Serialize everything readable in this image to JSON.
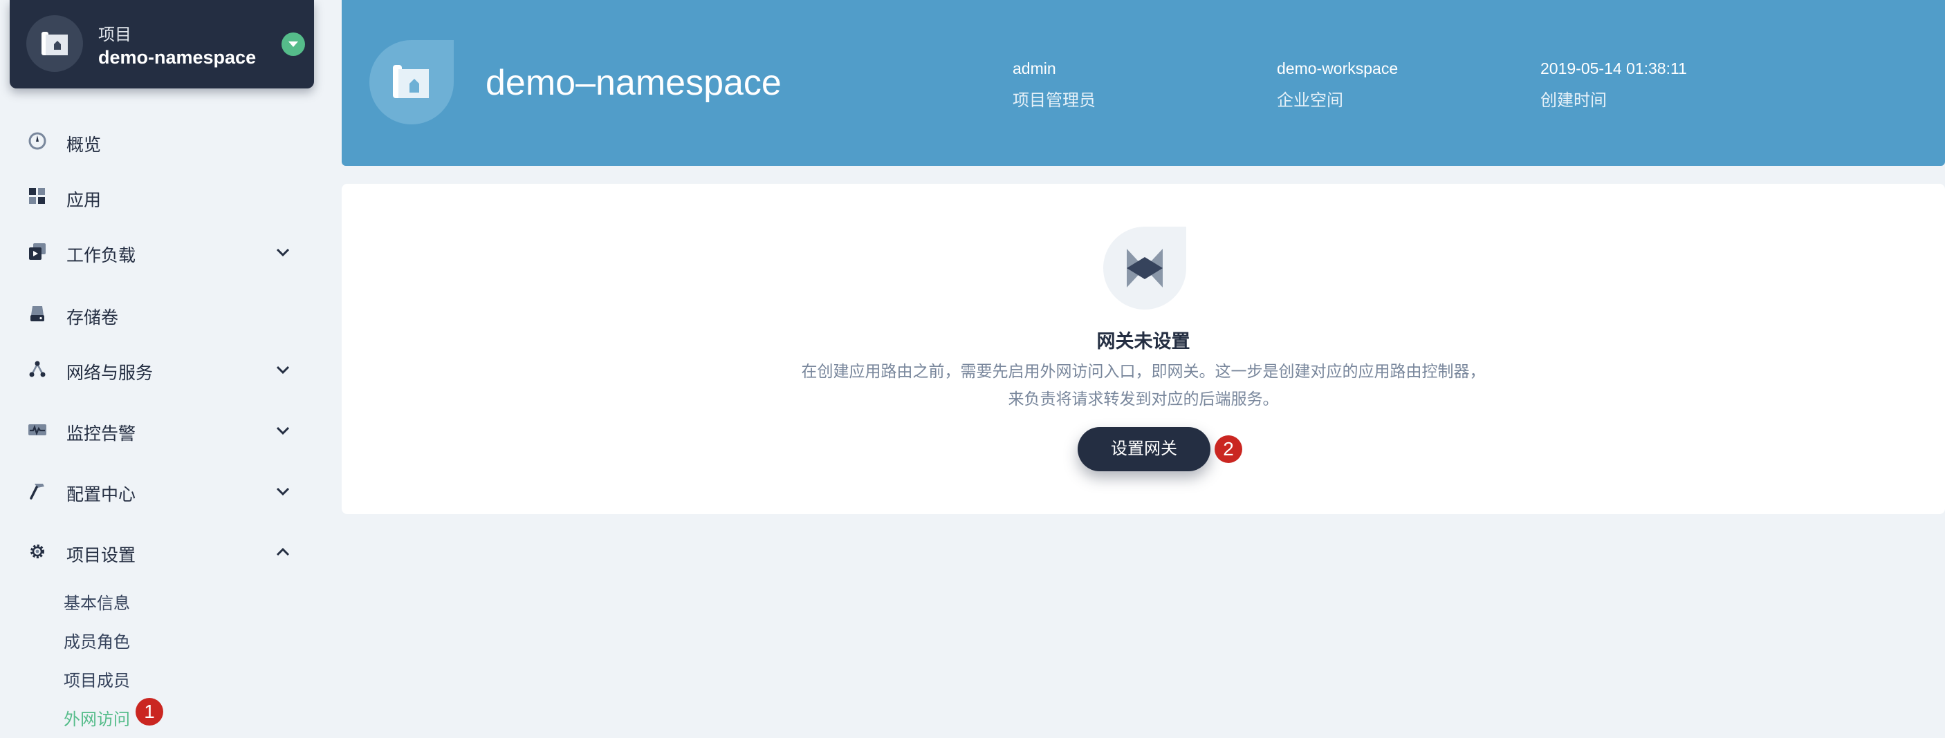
{
  "project": {
    "kind_label": "项目",
    "name": "demo-namespace"
  },
  "nav": {
    "items": [
      {
        "label": "概览",
        "icon": "dashboard-icon"
      },
      {
        "label": "应用",
        "icon": "apps-icon"
      },
      {
        "label": "工作负载",
        "icon": "workload-icon",
        "expandable": true
      },
      {
        "label": "存储卷",
        "icon": "storage-icon"
      },
      {
        "label": "网络与服务",
        "icon": "network-icon",
        "expandable": true
      },
      {
        "label": "监控告警",
        "icon": "monitor-icon",
        "expandable": true
      },
      {
        "label": "配置中心",
        "icon": "hammer-icon",
        "expandable": true
      },
      {
        "label": "项目设置",
        "icon": "gear-icon",
        "expanded": true
      }
    ],
    "sub_items": [
      "基本信息",
      "成员角色",
      "项目成员",
      "外网访问"
    ],
    "active_sub": "外网访问"
  },
  "header": {
    "title": "demo–namespace",
    "meta": [
      {
        "value": "admin",
        "label": "项目管理员"
      },
      {
        "value": "demo-workspace",
        "label": "企业空间"
      },
      {
        "value": "2019-05-14 01:38:11",
        "label": "创建时间"
      }
    ]
  },
  "gateway": {
    "title": "网关未设置",
    "desc_line1": "在创建应用路由之前，需要先启用外网访问入口，即网关。这一步是创建对应的应用路由控制器，",
    "desc_line2": "来负责将请求转发到对应的后端服务。",
    "button": "设置网关"
  },
  "badges": {
    "first": "1",
    "second": "2"
  },
  "colors": {
    "accent": "#55bc8a",
    "banner": "#519dc9",
    "dark": "#242e42",
    "badge": "#ca2621"
  }
}
